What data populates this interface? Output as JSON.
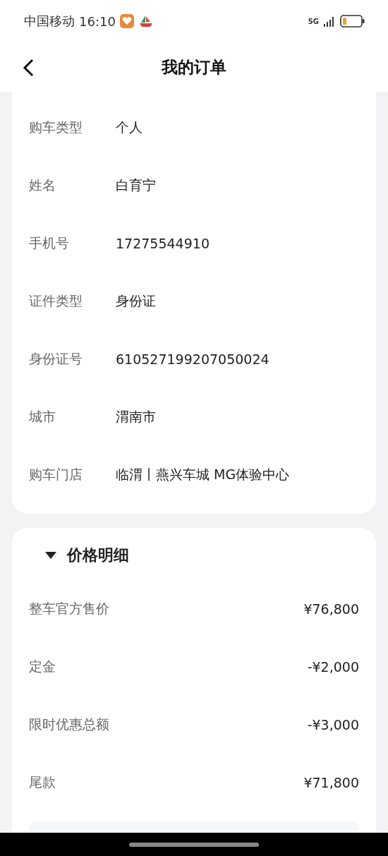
{
  "status_bar": {
    "carrier": "中国移动",
    "time": "16:10",
    "network": "5G"
  },
  "header": {
    "title": "我的订单"
  },
  "info_rows": [
    {
      "label": "购车类型",
      "value": "个人"
    },
    {
      "label": "姓名",
      "value": "白育宁"
    },
    {
      "label": "手机号",
      "value": "17275544910"
    },
    {
      "label": "证件类型",
      "value": "身份证"
    },
    {
      "label": "身份证号",
      "value": "610527199207050024"
    },
    {
      "label": "城市",
      "value": "渭南市"
    },
    {
      "label": "购车门店",
      "value": "临渭丨燕兴车城 MG体验中心"
    }
  ],
  "price_section": {
    "title": "价格明细",
    "expanded": true,
    "rows": [
      {
        "label": "整车官方售价",
        "value": "¥76,800"
      },
      {
        "label": "定金",
        "value": "-¥2,000"
      },
      {
        "label": "限时优惠总额",
        "value": "-¥3,000"
      },
      {
        "label": "尾款",
        "value": "¥71,800"
      }
    ]
  }
}
